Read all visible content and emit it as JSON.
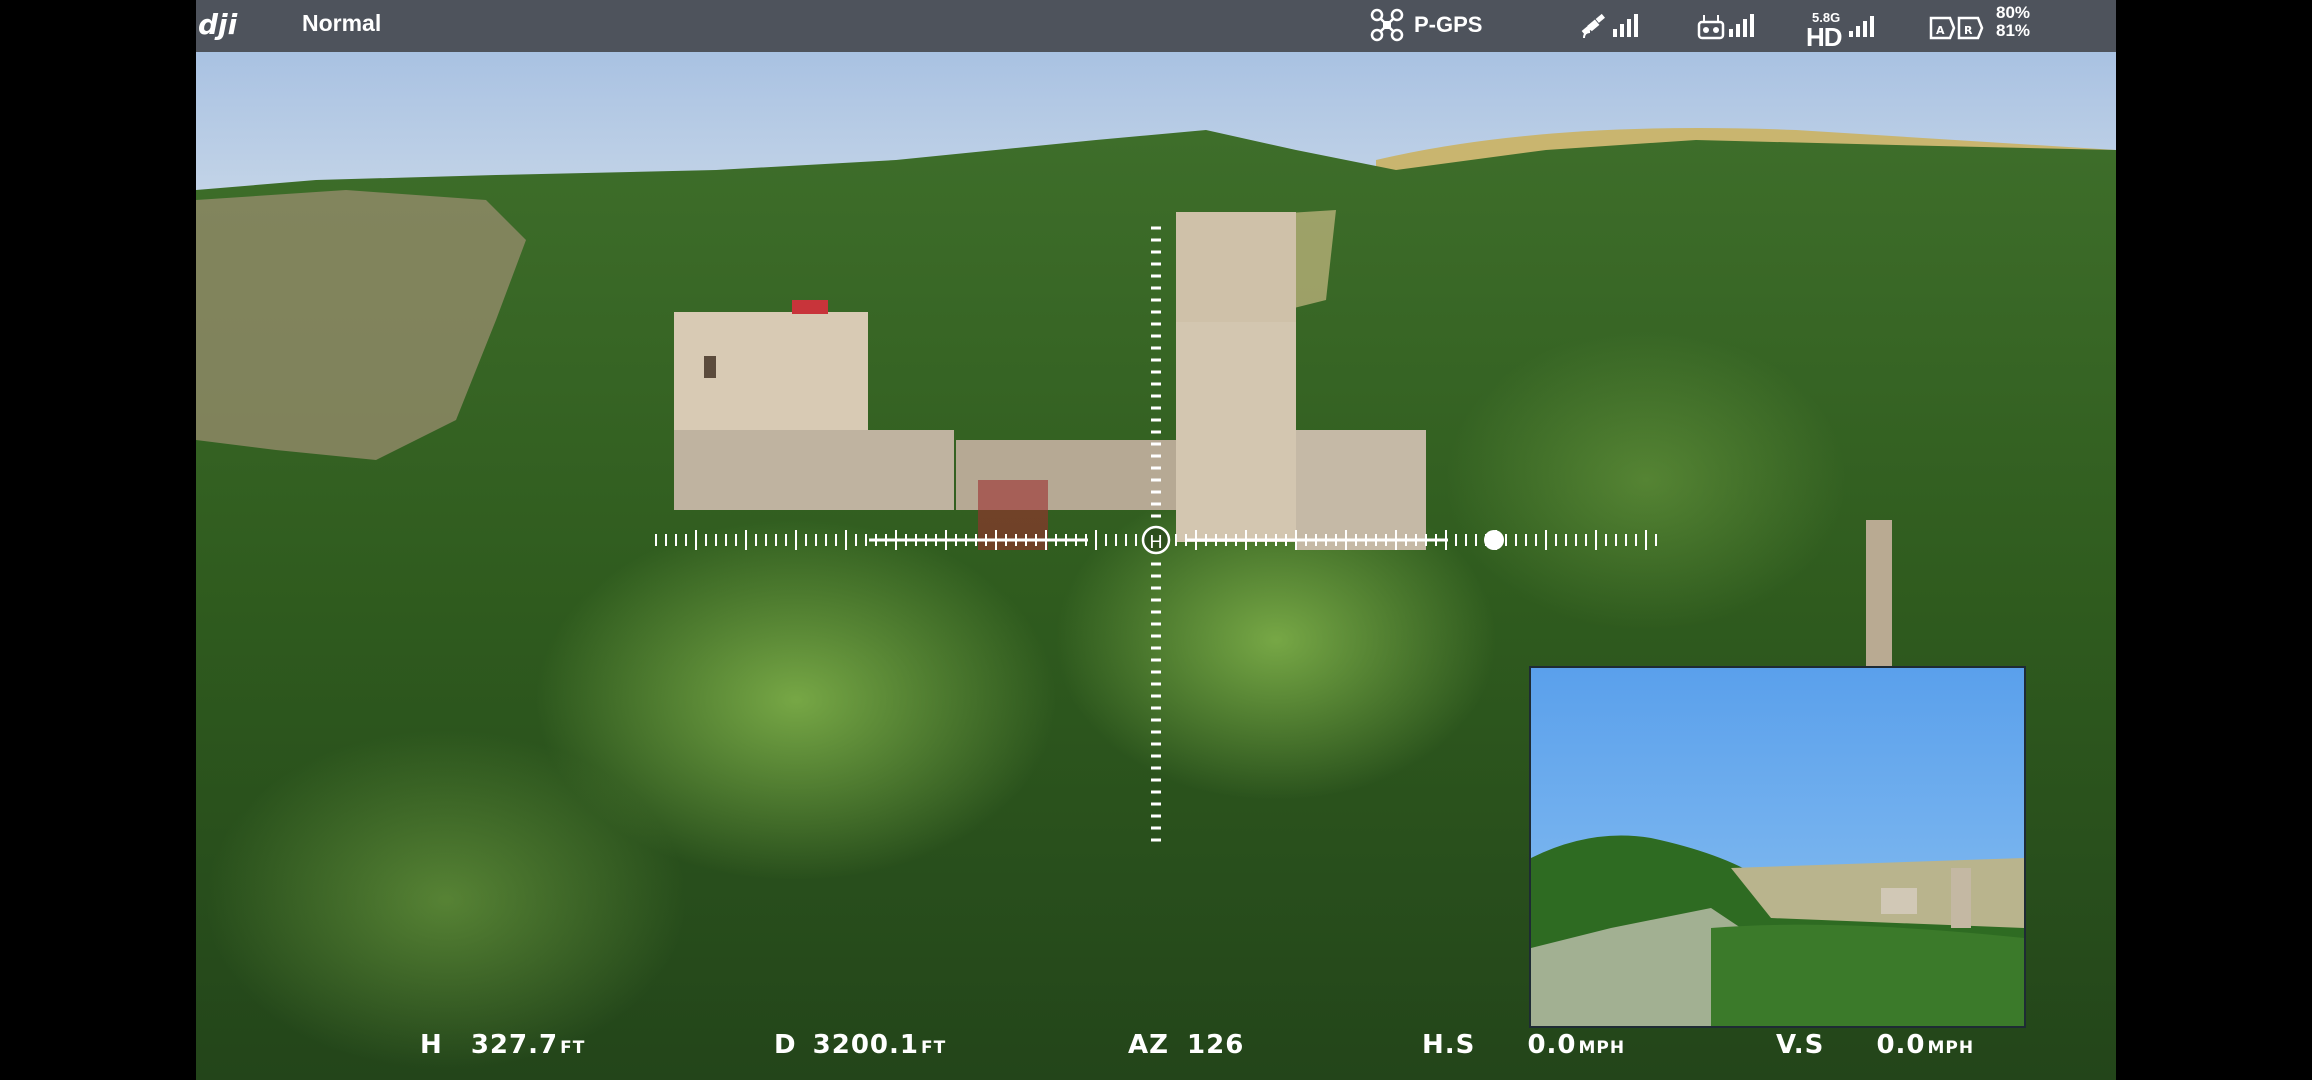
{
  "top_bar": {
    "logo_text": "dji",
    "flight_mode": "Normal",
    "gps_label": "P-GPS",
    "video_band": "5.8G",
    "video_label": "HD",
    "battery_aircraft": "80%",
    "battery_remote": "81%"
  },
  "attitude": {
    "heading_marker": "H"
  },
  "telemetry": {
    "height_label": "H",
    "height_value": "327.7",
    "height_unit": "FT",
    "distance_label": "D",
    "distance_value": "3200.1",
    "distance_unit": "FT",
    "azimuth_label": "AZ",
    "azimuth_value": "126",
    "hspeed_label": "H.S",
    "hspeed_value": "0.0",
    "hspeed_unit": "MPH",
    "vspeed_label": "V.S",
    "vspeed_value": "0.0",
    "vspeed_unit": "MPH"
  },
  "colors": {
    "top_bar_bg": "#464a50",
    "sky": "#a9c6e6",
    "forest": "#2f5a1e",
    "hud_white": "#ffffff"
  }
}
